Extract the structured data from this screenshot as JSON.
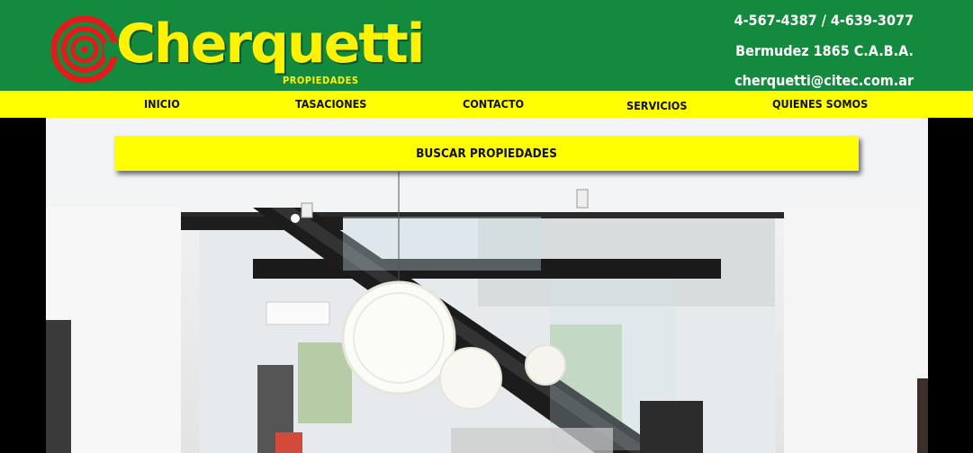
{
  "brand": {
    "name": "Cherquetti",
    "subtitle": "PROPIEDADES"
  },
  "contact": {
    "phones": "4-567-4387 / 4-639-3077",
    "address": "Bermudez 1865 C.A.B.A.",
    "email": "cherquetti@citec.com.ar"
  },
  "nav": {
    "items": [
      {
        "label": "INICIO"
      },
      {
        "label": "TASACIONES"
      },
      {
        "label": "CONTACTO"
      },
      {
        "label": "SERVICIOS"
      },
      {
        "label": "QUIENES SOMOS"
      }
    ]
  },
  "search": {
    "label": "BUSCAR PROPIEDADES"
  },
  "colors": {
    "header_green": "#148a3e",
    "brand_yellow": "#fff200",
    "nav_yellow": "#ffff00",
    "logo_red": "#e21b1b"
  }
}
